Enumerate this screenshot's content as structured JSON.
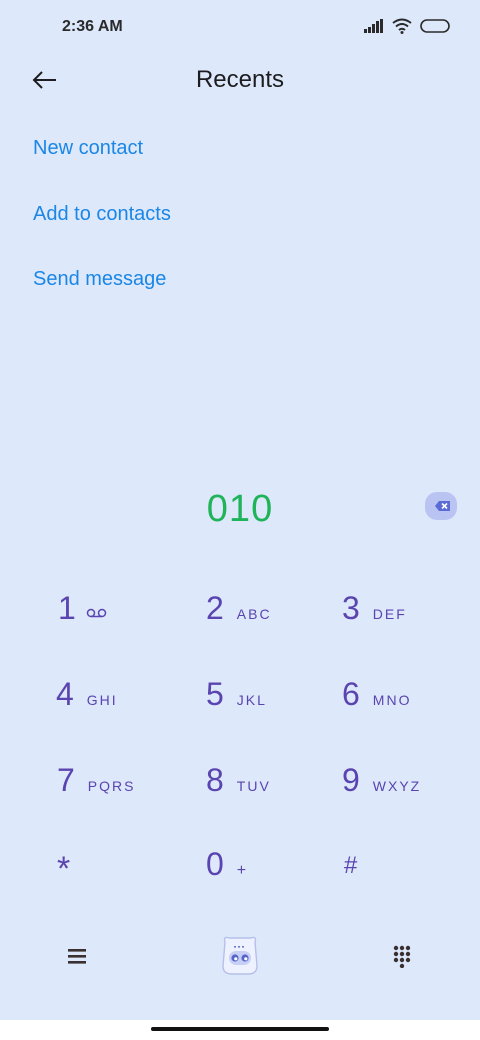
{
  "status": {
    "time": "2:36 AM"
  },
  "header": {
    "title": "Recents"
  },
  "actions": [
    {
      "label": "New contact"
    },
    {
      "label": "Add to contacts"
    },
    {
      "label": "Send message"
    }
  ],
  "dialed_number": "010",
  "keypad": [
    {
      "digit": "1",
      "letters": "",
      "extra_icon": "voicemail-icon"
    },
    {
      "digit": "2",
      "letters": "ABC"
    },
    {
      "digit": "3",
      "letters": "DEF"
    },
    {
      "digit": "4",
      "letters": "GHI"
    },
    {
      "digit": "5",
      "letters": "JKL"
    },
    {
      "digit": "6",
      "letters": "MNO"
    },
    {
      "digit": "7",
      "letters": "PQRS"
    },
    {
      "digit": "8",
      "letters": "TUV"
    },
    {
      "digit": "9",
      "letters": "WXYZ"
    },
    {
      "digit": "*",
      "letters": ""
    },
    {
      "digit": "0",
      "letters": "+"
    },
    {
      "digit": "#",
      "letters": ""
    }
  ],
  "bottom_bar": {
    "left_icon": "menu-icon",
    "center_icon": "assistant-robot-icon",
    "right_icon": "dialpad-icon"
  },
  "colors": {
    "background": "#dde8fb",
    "link": "#1a86e6",
    "keypad": "#5a44b0",
    "number": "#1fb45a"
  }
}
